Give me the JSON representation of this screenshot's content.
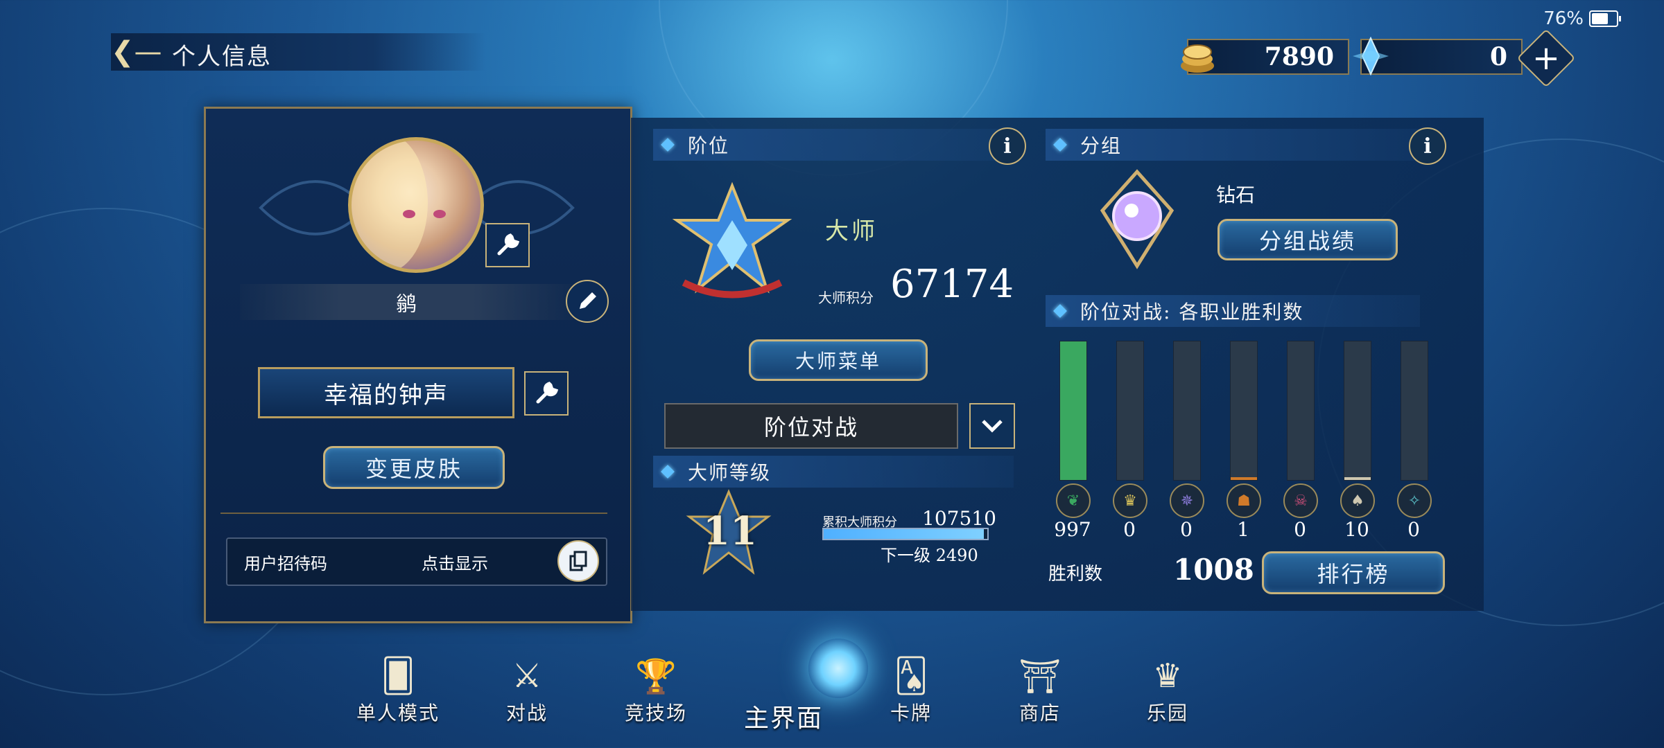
{
  "status": {
    "battery": "76%",
    "battery_level": 0.76
  },
  "header": {
    "title": "个人信息"
  },
  "currency": {
    "gold": "7890",
    "crystal": "0"
  },
  "profile": {
    "name": "鹟",
    "title": "幸福的钟声",
    "change_skin": "变更皮肤",
    "invite_label": "用户招待码",
    "invite_value": "点击显示"
  },
  "rank": {
    "header": "阶位",
    "rank_name": "大师",
    "points_label": "大师积分",
    "points": "67174",
    "menu_button": "大师菜单",
    "dropdown_value": "阶位对战"
  },
  "master_level": {
    "header": "大师等级",
    "level": "11",
    "cumulative_label": "累积大师积分",
    "cumulative_points": "107510",
    "next_label": "下一级",
    "next_points": "2490",
    "progress": 0.98
  },
  "group": {
    "header": "分组",
    "tier": "钻石",
    "button": "分组战绩"
  },
  "class_wins": {
    "header": "阶位对战: 各职业胜利数",
    "classes": [
      {
        "icon": "leaf-icon",
        "count": "997",
        "value": 997,
        "color": "#3aa860"
      },
      {
        "icon": "crown-icon",
        "count": "0",
        "value": 0,
        "color": "#d8c15a"
      },
      {
        "icon": "rune-icon",
        "count": "0",
        "value": 0,
        "color": "#8a7ad8"
      },
      {
        "icon": "dragon-icon",
        "count": "1",
        "value": 1,
        "color": "#d07a2a"
      },
      {
        "icon": "skull-icon",
        "count": "0",
        "value": 0,
        "color": "#d0507a"
      },
      {
        "icon": "bat-icon",
        "count": "10",
        "value": 10,
        "color": "#cfc7b0"
      },
      {
        "icon": "haven-icon",
        "count": "0",
        "value": 0,
        "color": "#5ac0c8"
      }
    ],
    "wins_label": "胜利数",
    "wins_total": "1008",
    "leaderboard_button": "排行榜"
  },
  "nav": [
    {
      "label": "单人模式",
      "icon": "solo-cards-icon",
      "glyph": "🂠"
    },
    {
      "label": "对战",
      "icon": "crossed-swords-icon",
      "glyph": "⚔"
    },
    {
      "label": "竞技场",
      "icon": "trophy-icon",
      "glyph": "🏆"
    },
    {
      "label": "主界面",
      "icon": "home-hub-icon",
      "glyph": ""
    },
    {
      "label": "卡牌",
      "icon": "cards-icon",
      "glyph": "🂡"
    },
    {
      "label": "商店",
      "icon": "shop-icon",
      "glyph": "⛩"
    },
    {
      "label": "乐园",
      "icon": "park-icon",
      "glyph": "♛"
    }
  ]
}
